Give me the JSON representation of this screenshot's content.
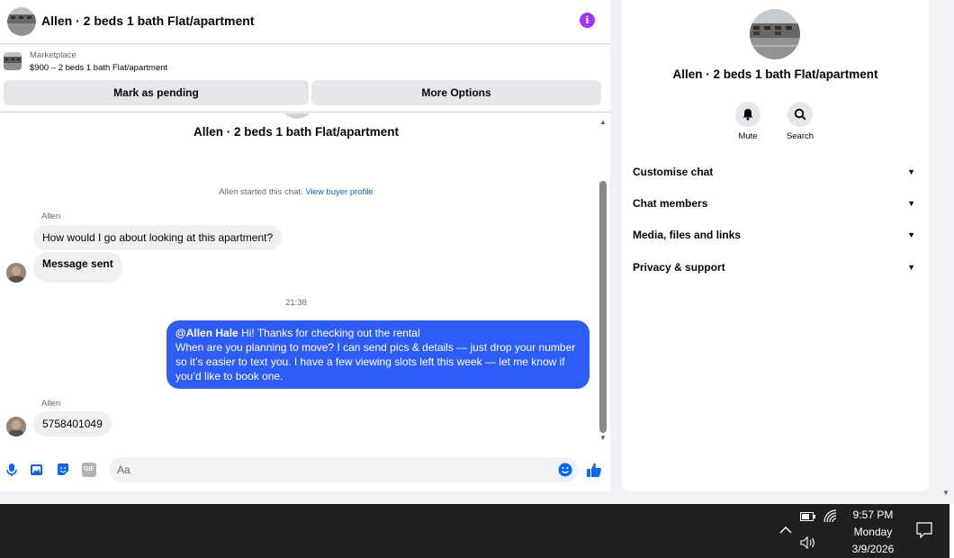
{
  "header": {
    "title": "Allen · 2 beds 1 bath Flat/apartment",
    "info_icon": "info-icon",
    "accent_color": "#a033ff"
  },
  "listing": {
    "category": "Marketplace",
    "summary": "$900 – 2 beds 1 bath Flat/apartment",
    "mark_pending_label": "Mark as pending",
    "more_options_label": "More Options"
  },
  "thread": {
    "title": "Allen · 2 beds 1 bath Flat/apartment",
    "started_text": "Allen started this chat.",
    "view_profile_link": "View buyer profile",
    "messages": [
      {
        "sender": "Allen",
        "text": "How would I  go about looking at this apartment?"
      },
      {
        "sender": "",
        "text": "Message sent"
      }
    ],
    "timestamp": "21:38",
    "outgoing": {
      "mention": "@Allen Hale",
      "line1": " Hi! Thanks for checking out the rental",
      "line2": "When are you planning to move? I can send pics & details — just drop your number",
      "line3": "so it’s easier to text you. I have a few viewing slots left this week — let me know if",
      "line4": "you’d like to book one.",
      "color": "#2e5cf6"
    },
    "reply": {
      "sender": "Allen",
      "text": "5758401049"
    }
  },
  "composer": {
    "placeholder": "Aa",
    "icons": [
      "microphone-icon",
      "photo-icon",
      "sticker-icon",
      "gif-icon",
      "emoji-icon",
      "thumbs-up-icon"
    ],
    "gif_label": "GIF"
  },
  "details": {
    "title": "Allen · 2 beds 1 bath Flat/apartment",
    "mute_label": "Mute",
    "search_label": "Search",
    "sections": [
      {
        "label": "Customise chat"
      },
      {
        "label": "Chat members"
      },
      {
        "label": "Media, files and links"
      },
      {
        "label": "Privacy & support"
      }
    ]
  },
  "taskbar": {
    "time": "9:57 PM",
    "day": "Monday",
    "date": "3/9/2026",
    "icons": [
      "chevron-up-icon",
      "battery-icon",
      "wifi-icon",
      "volume-icon",
      "notification-icon"
    ]
  }
}
